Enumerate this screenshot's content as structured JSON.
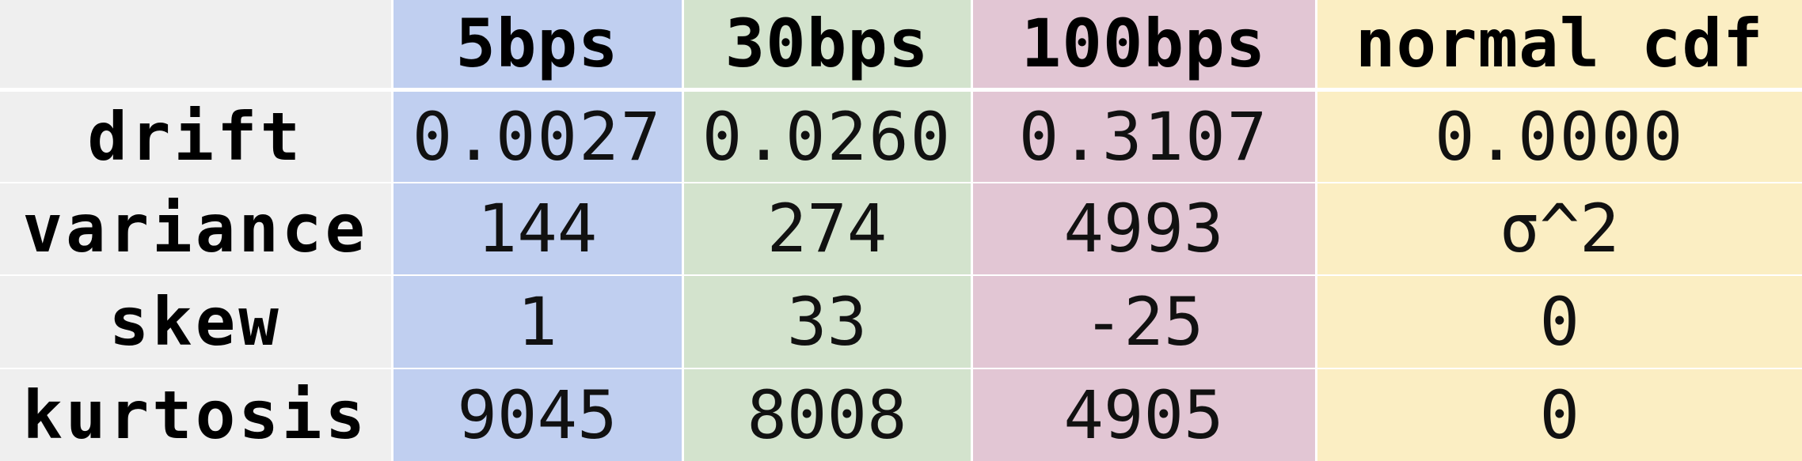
{
  "table": {
    "corner": "",
    "columns": [
      "5bps",
      "30bps",
      "100bps",
      "normal cdf"
    ],
    "rows": [
      {
        "label": "drift",
        "values": [
          "0.0027",
          "0.0260",
          "0.3107",
          "0.0000"
        ]
      },
      {
        "label": "variance",
        "values": [
          "144",
          "274",
          "4993",
          "σ^2"
        ]
      },
      {
        "label": "skew",
        "values": [
          "1",
          "33",
          "-25",
          "0"
        ]
      },
      {
        "label": "kurtosis",
        "values": [
          "9045",
          "8008",
          "4905",
          "0"
        ]
      }
    ],
    "colors": {
      "label_column": "#efefef",
      "col_5bps": "#c0cff0",
      "col_30bps": "#d3e3cd",
      "col_100bps": "#e2c6d4",
      "col_normal_cdf": "#fbeec3"
    }
  }
}
